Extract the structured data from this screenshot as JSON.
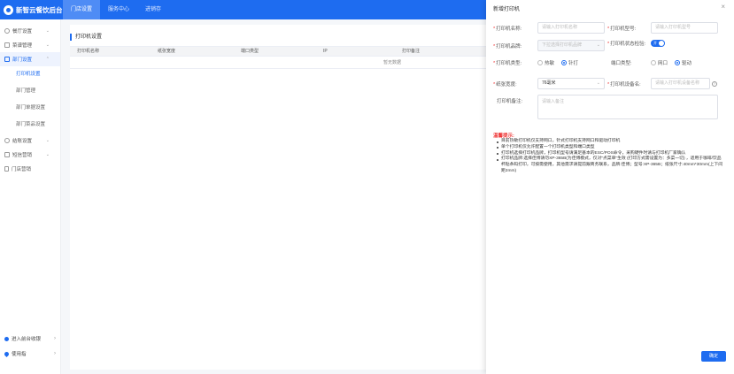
{
  "app": {
    "title": "新智云餐饮后台"
  },
  "topnav": {
    "tabs": [
      "门店设置",
      "服务中心",
      "进销存"
    ],
    "active_index": 0
  },
  "sidebar": {
    "groups": [
      {
        "label": "餐厅设置",
        "icon": "settings-icon"
      },
      {
        "label": "菜谱管理",
        "icon": "grid-icon"
      },
      {
        "label": "部门设置",
        "icon": "grid-icon",
        "active": true
      },
      {
        "label": "结账设置",
        "icon": "circle-icon"
      },
      {
        "label": "短信营销",
        "icon": "grid-icon"
      },
      {
        "label": "门店营销",
        "icon": "doc-icon"
      }
    ],
    "subitems": [
      "打印机设置",
      "部门管理",
      "部门单据设置",
      "部门菜品设置"
    ],
    "active_sub": 0,
    "bottom": [
      {
        "label": "进入前台收银",
        "icon": "dot-icon"
      },
      {
        "label": "使用指",
        "icon": "location-icon"
      }
    ]
  },
  "main": {
    "title": "打印机设置",
    "columns": [
      "打印机名称",
      "纸张宽度",
      "端口类型",
      "IP",
      "打印备注"
    ],
    "empty_text": "暂无数据"
  },
  "drawer": {
    "title": "新增打印机",
    "close_icon": "close-icon",
    "fields": {
      "name": {
        "label": "打印机名称:",
        "placeholder": "请输入打印机名称"
      },
      "model": {
        "label": "打印机型号:",
        "placeholder": "请输入打印机型号"
      },
      "brand": {
        "label": "打印机品牌:",
        "placeholder": "下拉选择打印机品牌"
      },
      "status_check": {
        "label": "打印机状态检验:",
        "value": "开"
      },
      "type": {
        "label": "打印机类型:",
        "options": [
          "热敏",
          "针打"
        ],
        "selected": 1
      },
      "port": {
        "label": "端口类型:",
        "options": [
          "网口",
          "驱动"
        ],
        "selected": 1
      },
      "paper": {
        "label": "纸张宽度:",
        "value": "76毫米"
      },
      "device": {
        "label": "打印机设备名:",
        "placeholder": "请输入打印机设备名称"
      },
      "remark": {
        "label": "打印机备注:",
        "placeholder": "请输入备注"
      }
    },
    "tips_title": "温馨提示:",
    "tips": [
      "目前热敏打印机仅支持网口，针式打印机支持网口和驱动打印机",
      "单个打印机仅允许配置一个打印机类型和端口类型",
      "打印机选择打印机品牌，打印机型号请满足基本的ESC/POS命令，采购硬件时请与打印机厂家确认",
      "打印机品牌:选择佳博请勿XP-365B(为佳博模式，仅对\"点菜单\"生效 (打印方式需设置为：多菜一切) ，适用于咖啡/饮品杯贴条码打印，可按需使用，其他需求请提前跟商务联系，品牌:佳博；型号:XP-365B；纸张尺寸:40mm*30mm(上下间距2mm)"
    ],
    "confirm_label": "确定"
  }
}
